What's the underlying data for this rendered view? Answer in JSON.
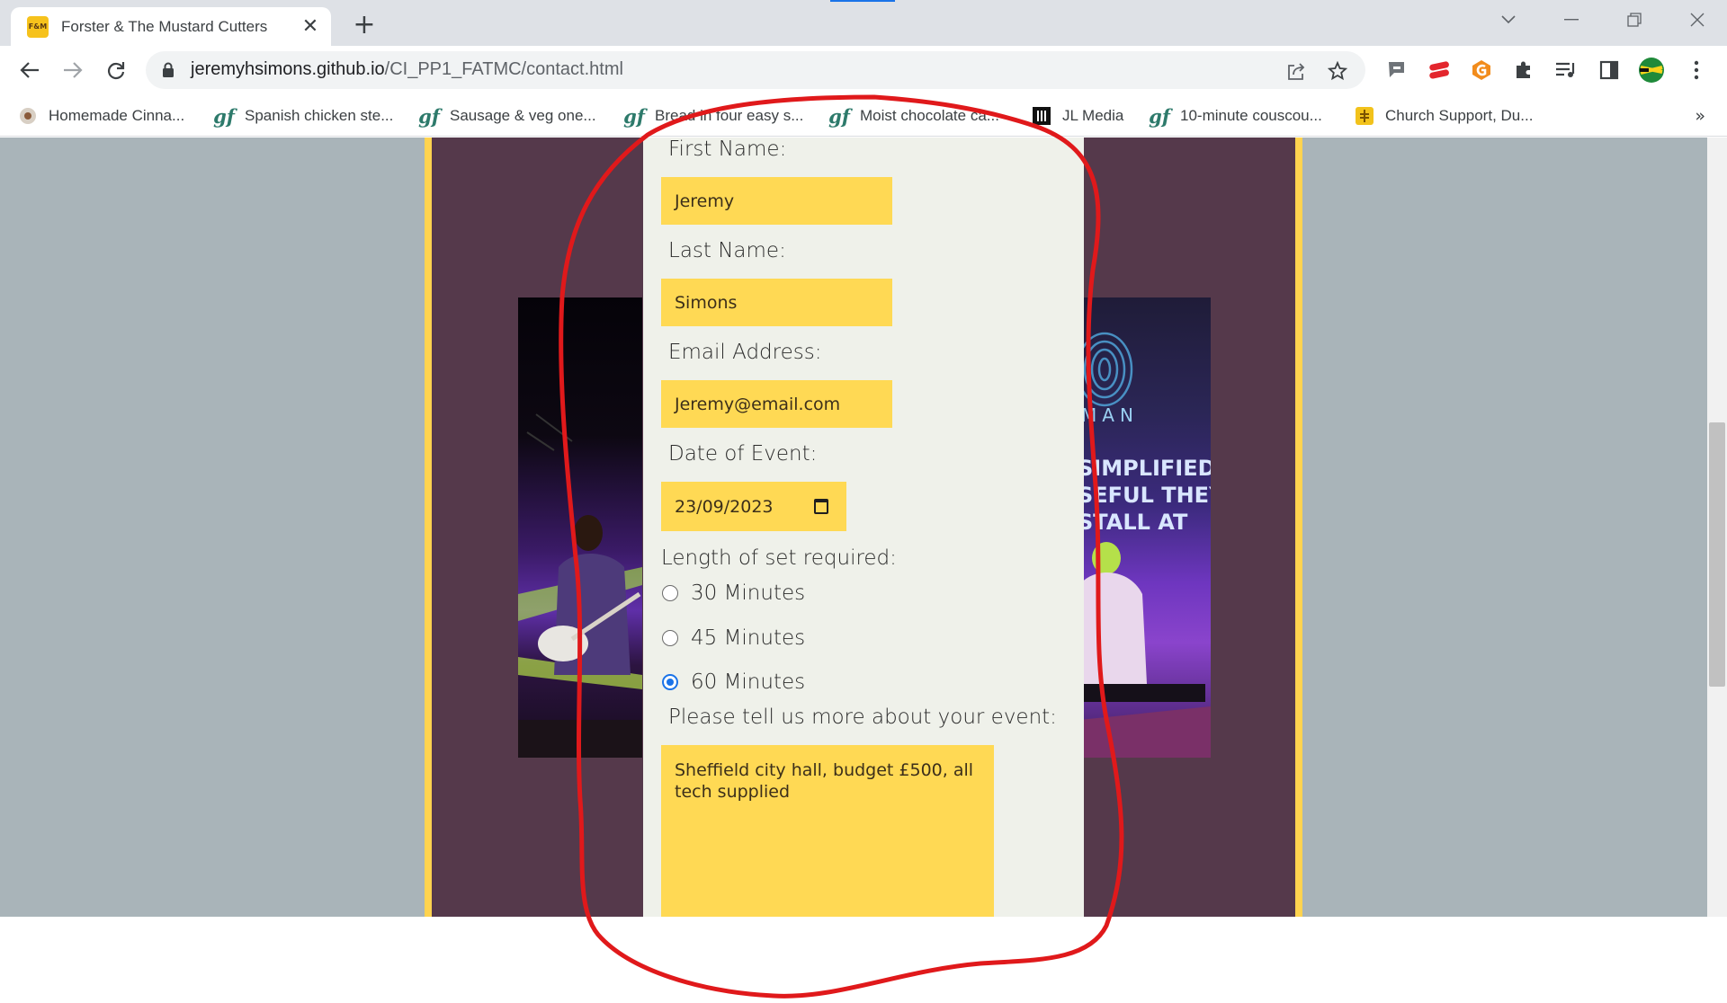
{
  "browser": {
    "tab": {
      "favicon_text": "F&M",
      "title": "Forster & The Mustard Cutters",
      "close_glyph": "✕"
    },
    "new_tab_glyph": "+",
    "url": {
      "host": "jeremyhsimons.github.io",
      "path": "/CI_PP1_FATMC/contact.html"
    },
    "bookmarks": [
      {
        "icon": "cinnamon-favicon",
        "label": "Homemade Cinna..."
      },
      {
        "icon": "gf-favicon",
        "label": "Spanish chicken ste..."
      },
      {
        "icon": "gf-favicon",
        "label": "Sausage & veg one..."
      },
      {
        "icon": "gf-favicon",
        "label": "Bread in four easy s..."
      },
      {
        "icon": "gf-favicon",
        "label": "Moist chocolate ca..."
      },
      {
        "icon": "jl-media-favicon",
        "label": "JL Media"
      },
      {
        "icon": "gf-favicon",
        "label": "10-minute couscou..."
      },
      {
        "icon": "church-favicon",
        "label": "Church Support, Du..."
      }
    ],
    "bookmarks_more": "»"
  },
  "form": {
    "first_name_label": "First Name:",
    "first_name_value": "Jeremy",
    "last_name_label": "Last Name:",
    "last_name_value": "Simons",
    "email_label": "Email Address:",
    "email_value": "Jeremy@email.com",
    "date_label": "Date of Event:",
    "date_value": "23/09/2023",
    "set_length_label": "Length of set required:",
    "set_options": [
      {
        "label": "30 Minutes",
        "checked": false
      },
      {
        "label": "45 Minutes",
        "checked": false
      },
      {
        "label": "60 Minutes",
        "checked": true
      }
    ],
    "details_label": "Please tell us more about your event:",
    "details_value": "Sheffield city hall, budget £500, all tech supplied"
  },
  "photo_right_text": {
    "line1": "MAN",
    "line2": "SIMPLIFIED I",
    "line3": "SEFUL THEY",
    "line4": "STALL AT"
  },
  "colors": {
    "page_bg": "#a9b4b9",
    "frame_yellow": "#ffd34f",
    "plum": "#55394b",
    "panel": "#eff1ea",
    "field_yellow": "#ffd954",
    "annotation_red": "#e0191b",
    "radio_blue": "#1a73e8"
  }
}
